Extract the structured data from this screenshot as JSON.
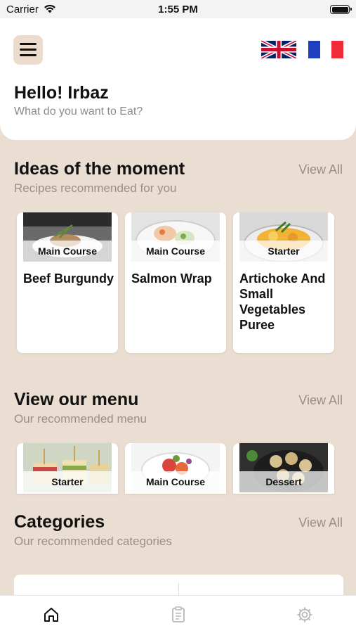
{
  "status": {
    "carrier": "Carrier",
    "time": "1:55 PM"
  },
  "header": {
    "greeting": "Hello! Irbaz",
    "subtitle": "What do you want to Eat?",
    "languages": [
      "uk-flag",
      "french-flag"
    ]
  },
  "ideas": {
    "title": "Ideas of the moment",
    "subtitle": "Recipes recommended for you",
    "view_all": "View All",
    "cards": [
      {
        "tag": "Main Course",
        "title": "Beef Burgundy"
      },
      {
        "tag": "Main Course",
        "title": "Salmon Wrap"
      },
      {
        "tag": "Starter",
        "title": "Artichoke And Small Vegetables Puree"
      }
    ]
  },
  "menu": {
    "title": "View our menu",
    "subtitle": "Our recommended menu",
    "view_all": "View All",
    "cards": [
      {
        "tag": "Starter"
      },
      {
        "tag": "Main Course"
      },
      {
        "tag": "Dessert"
      }
    ]
  },
  "categories": {
    "title": "Categories",
    "subtitle": "Our recommended categories",
    "view_all": "View All"
  },
  "tabbar": {
    "icons": [
      "home-icon",
      "clipboard-icon",
      "gear-icon"
    ],
    "active_color": "#111111",
    "inactive_color": "#b8b8b8"
  },
  "colors": {
    "background": "#eaddd1",
    "menu_button": "#ecdccd",
    "muted_text": "#9a8f88"
  }
}
